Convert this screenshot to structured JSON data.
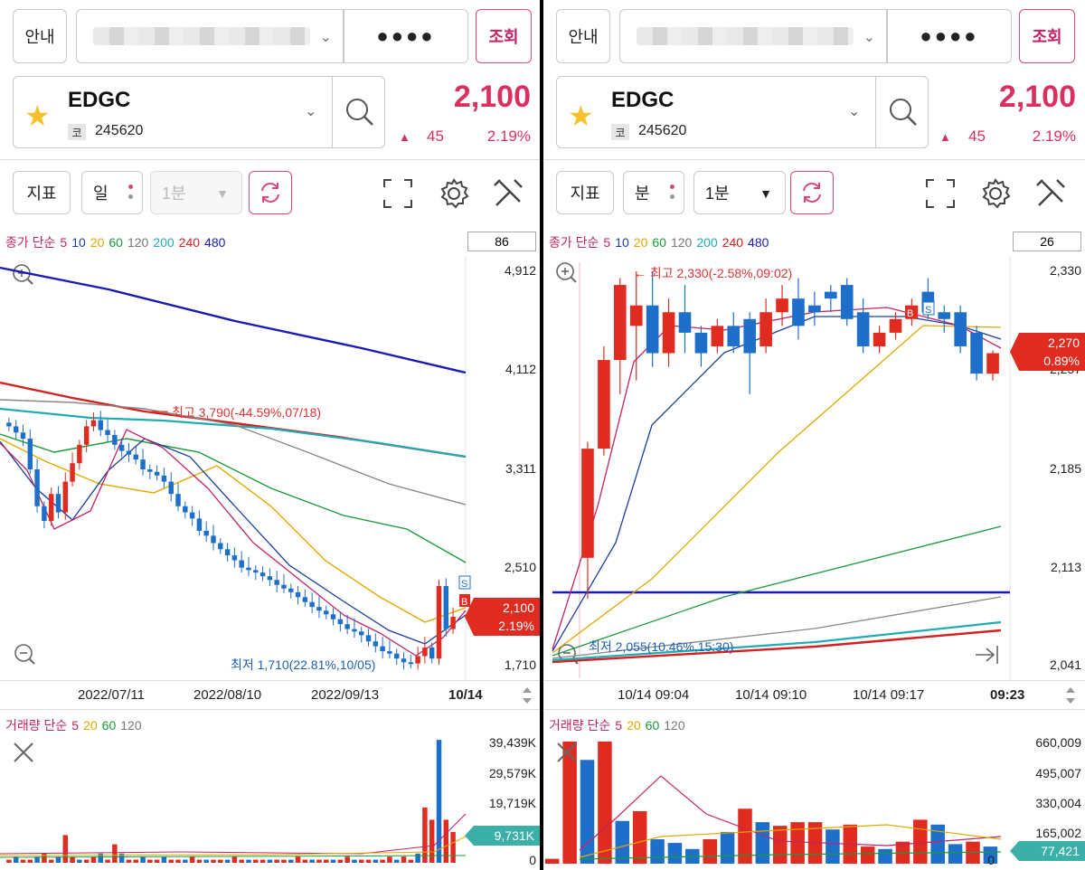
{
  "left": {
    "guide_label": "안내",
    "password_mask": "●●●●",
    "query_label": "조회",
    "stock": {
      "name": "EDGC",
      "code_badge": "코",
      "code": "245620"
    },
    "quote": {
      "price": "2,100",
      "change": "45",
      "change_pct": "2.19%",
      "direction": "up"
    },
    "toolbar": {
      "indicator": "지표",
      "period": "일",
      "interval": "1분",
      "interval_disabled": true
    },
    "legend": {
      "head": "종가 단순",
      "periods": [
        "5",
        "10",
        "20",
        "60",
        "120",
        "200",
        "240",
        "480"
      ]
    },
    "count": "86",
    "y_axis": [
      "4,912",
      "4,112",
      "3,311",
      "2,510",
      "1,710"
    ],
    "x_axis": [
      "2022/07/11",
      "2022/08/10",
      "2022/09/13"
    ],
    "x_last": "10/14",
    "high_note": "최고 3,790(-44.59%,07/18)",
    "low_note": "최저 1,710(22.81%,10/05)",
    "price_tag": [
      "2,100",
      "2.19%"
    ],
    "volume": {
      "legend": {
        "head": "거래량 단순",
        "periods": [
          "5",
          "20",
          "60",
          "120"
        ]
      },
      "y_axis": [
        "39,439K",
        "29,579K",
        "19,719K",
        "0"
      ],
      "tag": "9,731K"
    },
    "colors": {
      "up": "#e02b20",
      "down": "#1e6fc9",
      "accent": "#c12466"
    }
  },
  "right": {
    "guide_label": "안내",
    "password_mask": "●●●●",
    "query_label": "조회",
    "stock": {
      "name": "EDGC",
      "code_badge": "코",
      "code": "245620"
    },
    "quote": {
      "price": "2,100",
      "change": "45",
      "change_pct": "2.19%",
      "direction": "up"
    },
    "toolbar": {
      "indicator": "지표",
      "period": "분",
      "interval": "1분",
      "interval_disabled": false
    },
    "legend": {
      "head": "종가 단순",
      "periods": [
        "5",
        "10",
        "20",
        "60",
        "120",
        "200",
        "240",
        "480"
      ]
    },
    "count": "26",
    "y_axis": [
      "2,330",
      "2,257",
      "2,185",
      "2,113",
      "2,041"
    ],
    "x_axis": [
      "10/14 09:04",
      "10/14 09:10",
      "10/14 09:17"
    ],
    "x_last": "09:23",
    "high_note": "← 최고 2,330(-2.58%,09:02)",
    "low_note": "최저 2,055(10.46%,15:30)",
    "price_tag": [
      "2,270",
      "0.89%"
    ],
    "volume": {
      "legend": {
        "head": "거래량 단순",
        "periods": [
          "5",
          "20",
          "60",
          "120"
        ]
      },
      "y_axis": [
        "660,009",
        "495,007",
        "330,004",
        "165,002",
        "0"
      ],
      "tag": "77,421"
    }
  },
  "ma_colors": {
    "head": "#c12466",
    "5": "#c12466",
    "10": "#1a3fa0",
    "20": "#e0a800",
    "60": "#1a9a3a",
    "120": "#777777",
    "200": "#22aab5",
    "240": "#d42020",
    "480": "#1a1ab8"
  },
  "vol_colors": {
    "head": "#c12466",
    "5": "#c12466",
    "20": "#e0a800",
    "60": "#1a9a3a",
    "120": "#777777"
  }
}
